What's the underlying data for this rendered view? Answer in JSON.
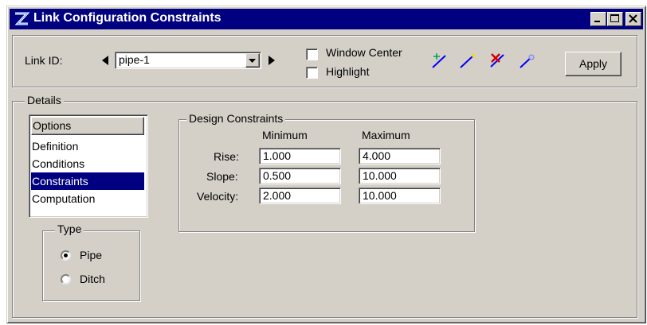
{
  "window": {
    "title": "Link Configuration Constraints"
  },
  "toolbar": {
    "link_id_label": "Link ID:",
    "link_id_value": "pipe-1",
    "window_center_label": "Window Center",
    "window_center_checked": false,
    "highlight_label": "Highlight",
    "highlight_checked": false,
    "apply_label": "Apply",
    "tool_icons": [
      "add-link-icon",
      "link-line-icon",
      "delete-link-icon",
      "link-properties-icon"
    ]
  },
  "details": {
    "label": "Details",
    "options_header": "Options",
    "options": [
      "Definition",
      "Conditions",
      "Constraints",
      "Computation"
    ],
    "selected_option": "Constraints",
    "type": {
      "label": "Type",
      "choices": [
        "Pipe",
        "Ditch"
      ],
      "selected": "Pipe"
    }
  },
  "design_constraints": {
    "label": "Design Constraints",
    "min_header": "Minimum",
    "max_header": "Maximum",
    "rows": [
      {
        "label": "Rise:",
        "min": "1.000",
        "max": "4.000"
      },
      {
        "label": "Slope:",
        "min": "0.500",
        "max": "10.000"
      },
      {
        "label": "Velocity:",
        "min": "2.000",
        "max": "10.000"
      }
    ]
  },
  "colors": {
    "titlebar": "#000080",
    "selection": "#000080",
    "face": "#d4d0c8"
  }
}
